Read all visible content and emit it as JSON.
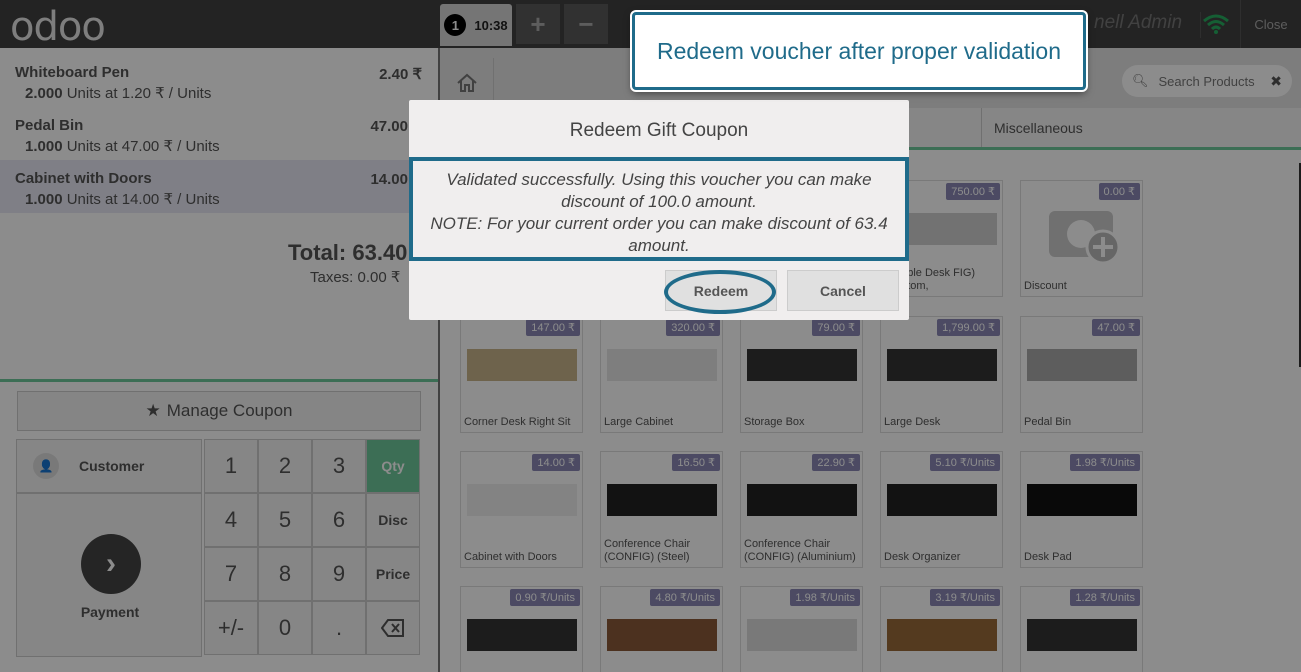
{
  "topbar": {
    "logo": "odoo",
    "order_number": "1",
    "order_time": "10:38",
    "add_label": "+",
    "remove_label": "−",
    "user": "nell Admin",
    "close_label": "Close"
  },
  "orderlines": [
    {
      "name": "Whiteboard Pen",
      "price": "2.40 ₹",
      "qty": "2.000",
      "info": "Units at 1.20 ₹ / Units",
      "selected": false
    },
    {
      "name": "Pedal Bin",
      "price": "47.00",
      "qty": "1.000",
      "info": "Units at 47.00 ₹ / Units",
      "selected": false
    },
    {
      "name": "Cabinet with Doors",
      "price": "14.00",
      "qty": "1.000",
      "info": "Units at 14.00 ₹ / Units",
      "selected": true
    }
  ],
  "summary": {
    "total": "Total: 63.40",
    "taxes": "Taxes: 0.00 ₹"
  },
  "manage_coupon": "Manage Coupon",
  "numpad": {
    "customer": "Customer",
    "payment": "Payment",
    "keys": [
      "1",
      "2",
      "3",
      "4",
      "5",
      "6",
      "7",
      "8",
      "9",
      "+/-",
      "0",
      "."
    ],
    "modes": [
      "Qty",
      "Disc",
      "Price"
    ]
  },
  "products_header": {
    "search_placeholder": "Search Products",
    "category": "Miscellaneous"
  },
  "products": [
    {
      "name": "mizable Desk\nFIG) (Custom,",
      "price": "750.00 ₹"
    },
    {
      "name": "Discount",
      "price": "0.00 ₹"
    },
    {
      "name": "Corner Desk Right Sit",
      "price": "147.00 ₹"
    },
    {
      "name": "Large Cabinet",
      "price": "320.00 ₹"
    },
    {
      "name": "Storage Box",
      "price": "79.00 ₹"
    },
    {
      "name": "Large Desk",
      "price": "1,799.00 ₹"
    },
    {
      "name": "Pedal Bin",
      "price": "47.00 ₹"
    },
    {
      "name": "Cabinet with Doors",
      "price": "14.00 ₹"
    },
    {
      "name": "Conference Chair (CONFIG) (Steel)",
      "price": "16.50 ₹"
    },
    {
      "name": "Conference Chair (CONFIG) (Aluminium)",
      "price": "22.90 ₹"
    },
    {
      "name": "Desk Organizer",
      "price": "5.10 ₹/Units"
    },
    {
      "name": "Desk Pad",
      "price": "1.98 ₹/Units"
    },
    {
      "name": "",
      "price": "0.90 ₹/Units"
    },
    {
      "name": "",
      "price": "4.80 ₹/Units"
    },
    {
      "name": "",
      "price": "1.98 ₹/Units"
    },
    {
      "name": "",
      "price": "3.19 ₹/Units"
    },
    {
      "name": "",
      "price": "1.28 ₹/Units"
    }
  ],
  "modal": {
    "title": "Redeem Gift Coupon",
    "line1": "Validated successfully. Using this voucher you can make discount of 100.0 amount.",
    "line2": "NOTE: For your current order you can make discount of 63.4 amount.",
    "redeem_label": "Redeem",
    "cancel_label": "Cancel"
  },
  "callout": "Redeem voucher after proper validation",
  "colors": {
    "accent": "#6ec89b",
    "annotation": "#1f6b8a",
    "badge": "#8a88b5"
  }
}
